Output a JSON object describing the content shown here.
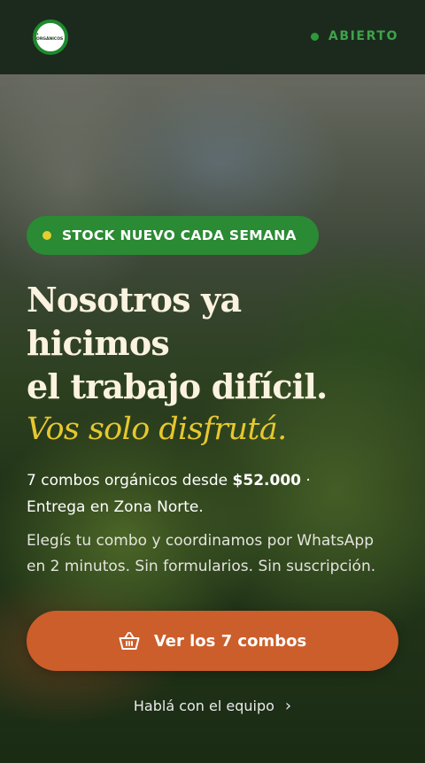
{
  "header": {
    "logo_text": "• ORGÁNICOS",
    "status": "ABIERTO"
  },
  "hero": {
    "badge": "STOCK NUEVO CADA SEMANA",
    "headline": {
      "line1": "Nosotros ya",
      "line2": "hicimos",
      "line3": "el trabajo difícil.",
      "accent": "Vos solo disfrutá."
    },
    "subtitle": {
      "prefix": "7 combos orgánicos desde ",
      "price": "$52.000",
      "suffix": " ·",
      "line2": "Entrega en Zona Norte."
    },
    "description": {
      "line1": "Elegís tu combo y coordinamos por WhatsApp",
      "line2": "en 2 minutos. Sin formularios. Sin suscripción."
    },
    "cta_label": "Ver los 7 combos",
    "cta_icon": "basket-icon",
    "secondary_link": "Hablá con el equipo",
    "secondary_icon": "chevron-right-icon"
  },
  "colors": {
    "topbar": "#1b2a1d",
    "accent_green": "#2b8a34",
    "accent_yellow": "#e6c82e",
    "cta_orange": "#cc5e2b",
    "headline": "#fbf3e0"
  }
}
